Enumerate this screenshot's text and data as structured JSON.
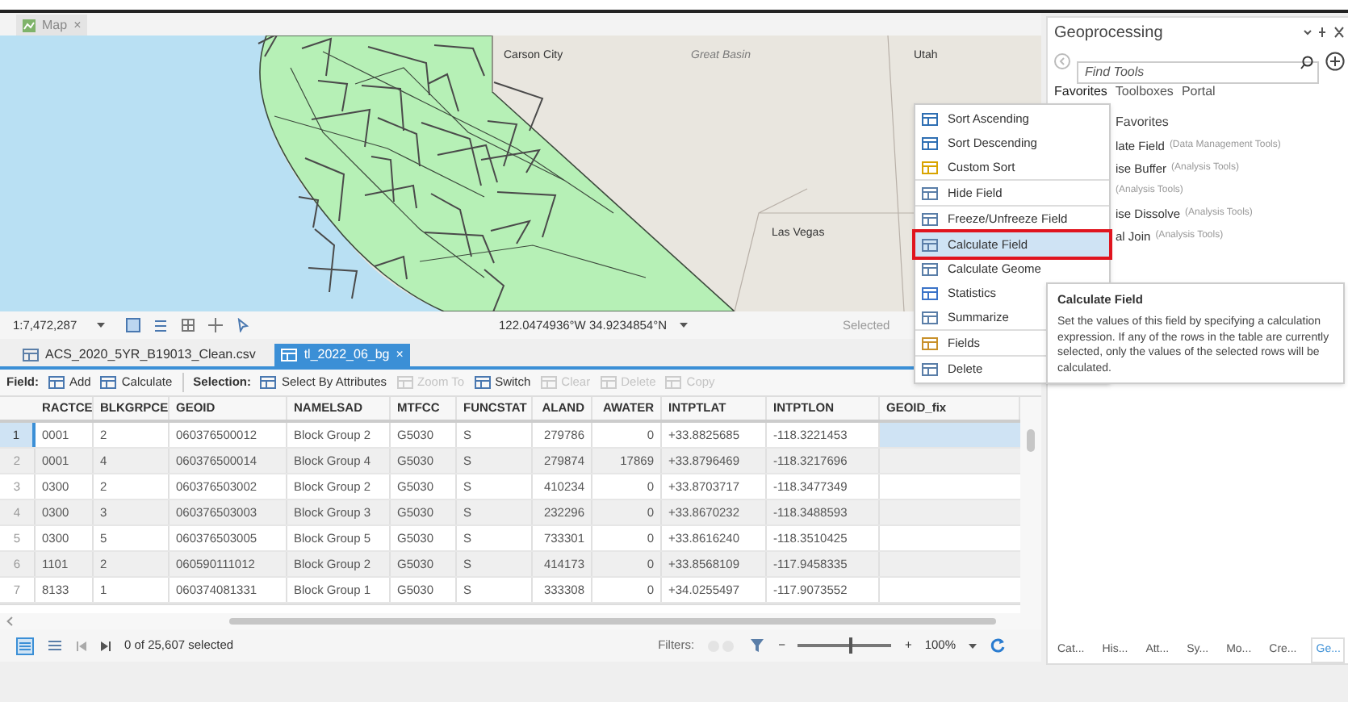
{
  "map_tab": {
    "label": "Map",
    "close": "×"
  },
  "map": {
    "labels": [
      "Carson City",
      "Great Basin",
      "Utah",
      "Las Vegas"
    ]
  },
  "map_status": {
    "scale": "1:7,472,287",
    "coordinates": "122.0474936°W 34.9234854°N",
    "selected_label": "Selected"
  },
  "table_tabs": [
    {
      "label": "ACS_2020_5YR_B19013_Clean.csv",
      "selected": false
    },
    {
      "label": "tl_2022_06_bg",
      "selected": true,
      "close": "×"
    }
  ],
  "toolbar": {
    "field_label": "Field:",
    "field_buttons": [
      {
        "label": "Add",
        "disabled": false
      },
      {
        "label": "Calculate",
        "disabled": false
      }
    ],
    "selection_label": "Selection:",
    "selection_buttons": [
      {
        "label": "Select By Attributes",
        "disabled": false
      },
      {
        "label": "Zoom To",
        "disabled": true
      },
      {
        "label": "Switch",
        "disabled": false
      },
      {
        "label": "Clear",
        "disabled": true
      },
      {
        "label": "Delete",
        "disabled": true
      },
      {
        "label": "Copy",
        "disabled": true
      }
    ]
  },
  "table": {
    "columns": [
      {
        "label": "RACTCE",
        "numeric": false
      },
      {
        "label": "BLKGRPCE",
        "numeric": false
      },
      {
        "label": "GEOID",
        "numeric": false
      },
      {
        "label": "NAMELSAD",
        "numeric": false
      },
      {
        "label": "MTFCC",
        "numeric": false
      },
      {
        "label": "FUNCSTAT",
        "numeric": false
      },
      {
        "label": "ALAND",
        "numeric": true
      },
      {
        "label": "AWATER",
        "numeric": true
      },
      {
        "label": "INTPTLAT",
        "numeric": false
      },
      {
        "label": "INTPTLON",
        "numeric": false
      },
      {
        "label": "GEOID_fix",
        "numeric": false
      }
    ],
    "rows": [
      {
        "number": "1",
        "selected": true,
        "cells": [
          "0001",
          "2",
          "060376500012",
          "Block Group 2",
          "G5030",
          "S",
          "279786",
          "0",
          "+33.8825685",
          "-118.3221453"
        ]
      },
      {
        "number": "2",
        "selected": false,
        "cells": [
          "0001",
          "4",
          "060376500014",
          "Block Group 4",
          "G5030",
          "S",
          "279874",
          "17869",
          "+33.8796469",
          "-118.3217696"
        ]
      },
      {
        "number": "3",
        "selected": false,
        "cells": [
          "0300",
          "2",
          "060376503002",
          "Block Group 2",
          "G5030",
          "S",
          "410234",
          "0",
          "+33.8703717",
          "-118.3477349"
        ]
      },
      {
        "number": "4",
        "selected": false,
        "cells": [
          "0300",
          "3",
          "060376503003",
          "Block Group 3",
          "G5030",
          "S",
          "232296",
          "0",
          "+33.8670232",
          "-118.3488593"
        ]
      },
      {
        "number": "5",
        "selected": false,
        "cells": [
          "0300",
          "5",
          "060376503005",
          "Block Group 5",
          "G5030",
          "S",
          "733301",
          "0",
          "+33.8616240",
          "-118.3510425"
        ]
      },
      {
        "number": "6",
        "selected": false,
        "cells": [
          "1101",
          "2",
          "060590111012",
          "Block Group 2",
          "G5030",
          "S",
          "414173",
          "0",
          "+33.8568109",
          "-117.9458335"
        ]
      },
      {
        "number": "7",
        "selected": false,
        "cells": [
          "8133",
          "1",
          "060374081331",
          "Block Group 1",
          "G5030",
          "S",
          "333308",
          "0",
          "+34.0255497",
          "-117.9073552"
        ]
      }
    ]
  },
  "status": {
    "selection": "0 of 25,607 selected",
    "filters_label": "Filters:",
    "zoom_minus": "−",
    "zoom": {
      "level": 0.55
    },
    "zoom_plus": "+",
    "zoom_value": "100%"
  },
  "context_menu": {
    "groups": [
      [
        {
          "label": "Sort Ascending",
          "selected": false
        },
        {
          "label": "Sort Descending",
          "selected": false
        },
        {
          "label": "Custom Sort",
          "selected": false
        }
      ],
      [
        {
          "label": "Hide Field",
          "selected": false
        }
      ],
      [
        {
          "label": "Freeze/Unfreeze Field",
          "selected": false
        }
      ],
      [
        {
          "label": "Calculate Field",
          "selected": true
        },
        {
          "label": "Calculate Geome",
          "selected": false
        },
        {
          "label": "Statistics",
          "selected": false
        },
        {
          "label": "Summarize",
          "selected": false
        }
      ],
      [
        {
          "label": "Fields",
          "selected": false
        }
      ],
      [
        {
          "label": "Delete",
          "selected": false
        }
      ]
    ]
  },
  "tooltip": {
    "title": "Calculate Field",
    "body": "Set the values of this field by specifying a calculation expression. If any of the rows in the table are currently selected, only the values of the selected rows will be calculated."
  },
  "geoprocessing": {
    "title": "Geoprocessing",
    "search_placeholder": "Find Tools",
    "tabs": [
      {
        "label": "Favorites",
        "selected": true
      },
      {
        "label": "Toolboxes",
        "selected": false
      },
      {
        "label": "Portal",
        "selected": false
      }
    ],
    "section": "Favorites",
    "tools": [
      {
        "name": "late Field",
        "toolbox": "(Data Management Tools)"
      },
      {
        "name": "ise Buffer",
        "toolbox": "(Analysis Tools)"
      },
      {
        "toolbox": "(Analysis Tools)"
      },
      {
        "name": "ise Dissolve",
        "toolbox": "(Analysis Tools)"
      },
      {
        "name": "al Join",
        "toolbox": "(Analysis Tools)"
      }
    ],
    "bottom_tabs": [
      {
        "label": "Cat...",
        "selected": false
      },
      {
        "label": "His...",
        "selected": false
      },
      {
        "label": "Att...",
        "selected": false
      },
      {
        "label": "Sy...",
        "selected": false
      },
      {
        "label": "Mo...",
        "selected": false
      },
      {
        "label": "Cre...",
        "selected": false
      },
      {
        "label": "Ge...",
        "selected": true
      }
    ]
  }
}
